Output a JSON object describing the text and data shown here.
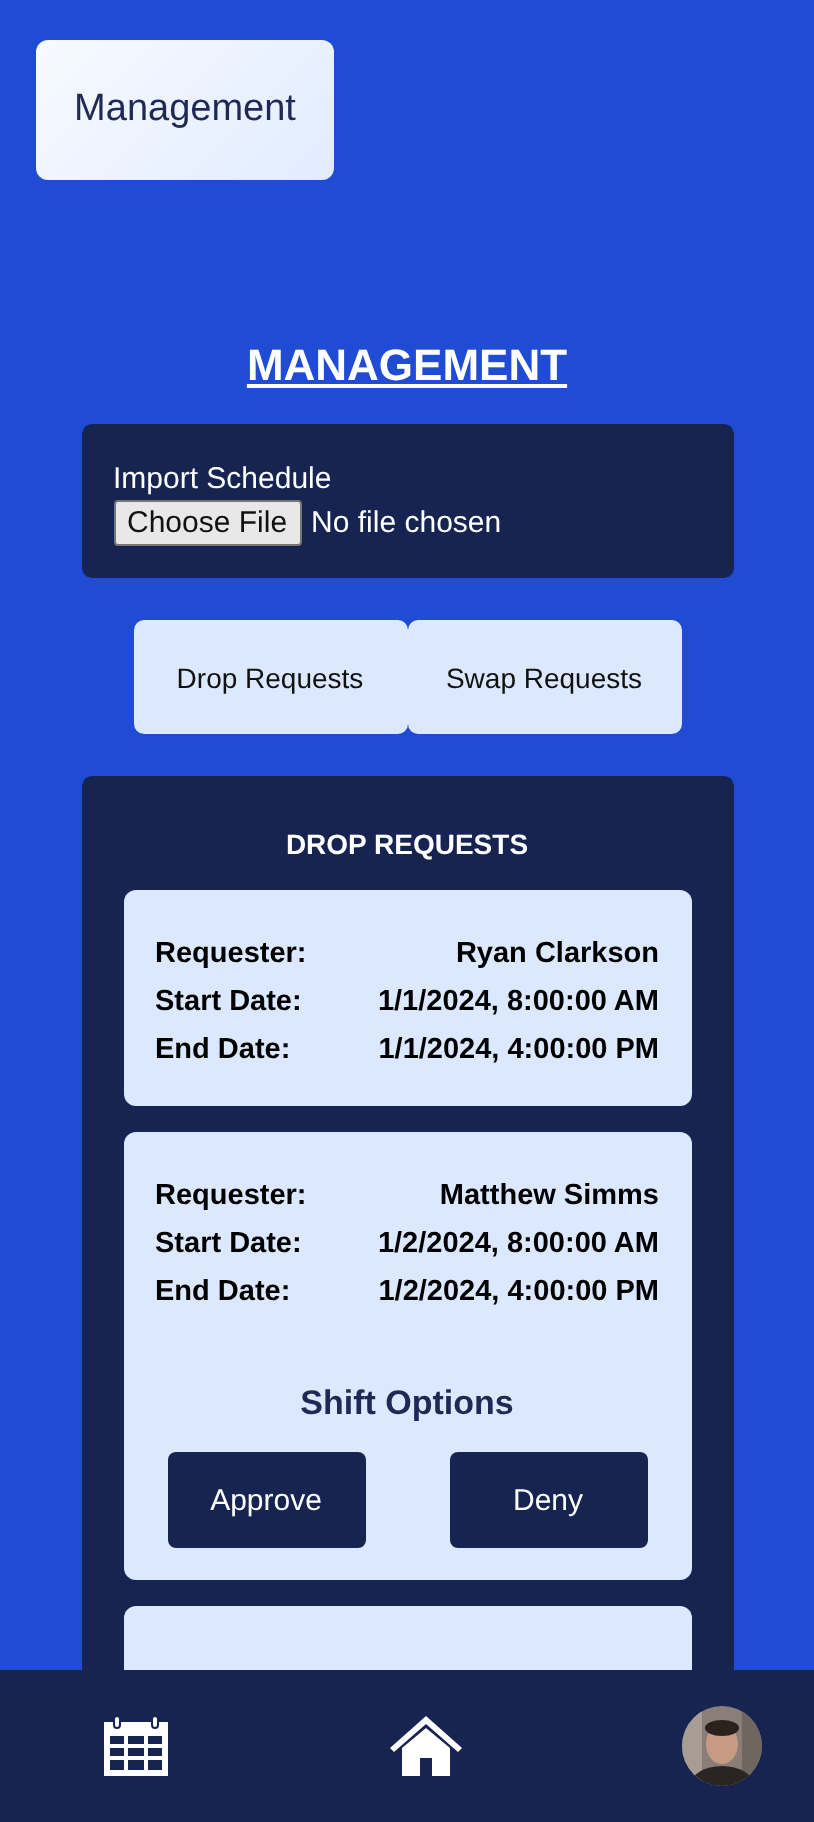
{
  "top_button": "Management",
  "heading": "MANAGEMENT",
  "import": {
    "label": "Import Schedule",
    "button": "Choose File",
    "status": "No file chosen"
  },
  "toggles": [
    {
      "label": "Drop Requests"
    },
    {
      "label": "Swap Requests"
    }
  ],
  "panel": {
    "title": "DROP REQUESTS",
    "requests": [
      {
        "kind": "request",
        "fields": [
          {
            "label": "Requester:",
            "value": "Ryan Clarkson"
          },
          {
            "label": "Start Date:",
            "value": "1/1/2024, 8:00:00 AM"
          },
          {
            "label": "End Date:",
            "value": "1/1/2024, 4:00:00 PM"
          }
        ]
      },
      {
        "kind": "request",
        "fields": [
          {
            "label": "Requester:",
            "value": "Matthew Simms"
          },
          {
            "label": "Start Date:",
            "value": "1/2/2024, 8:00:00 AM"
          },
          {
            "label": "End Date:",
            "value": "1/2/2024, 4:00:00 PM"
          }
        ],
        "options": {
          "title": "Shift Options",
          "buttons": [
            "Approve",
            "Deny"
          ]
        }
      },
      {
        "kind": "clipped"
      }
    ]
  },
  "nav": [
    {
      "kind": "calendar"
    },
    {
      "kind": "home"
    },
    {
      "kind": "avatar"
    }
  ]
}
